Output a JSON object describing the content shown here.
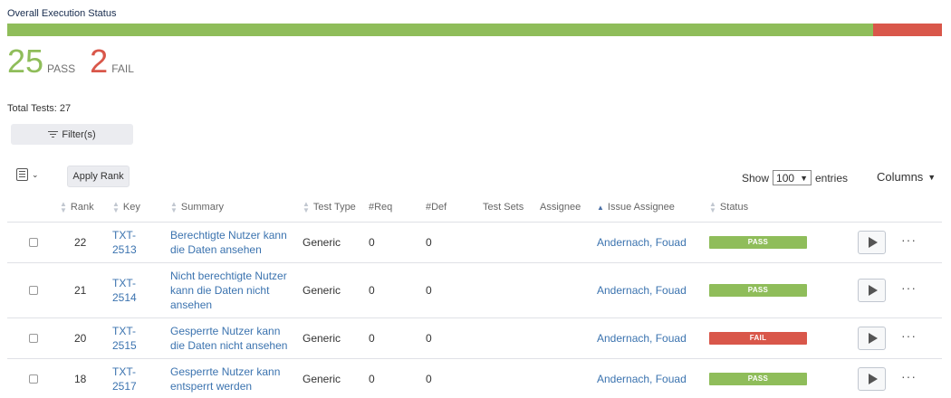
{
  "header": {
    "title": "Overall Execution Status"
  },
  "summary": {
    "pass_count": "25",
    "pass_label": "PASS",
    "fail_count": "2",
    "fail_label": "FAIL",
    "pass_fraction": 0.926,
    "total_tests": "Total Tests: 27"
  },
  "colors": {
    "pass": "#8fbd5a",
    "fail": "#d9574a",
    "link": "#3b73af"
  },
  "toolbar": {
    "filter_label": "Filter(s)",
    "apply_rank_label": "Apply Rank",
    "show_label": "Show",
    "entries_value": "100",
    "entries_label": "entries",
    "columns_label": "Columns"
  },
  "table": {
    "headers": {
      "rank": "Rank",
      "key": "Key",
      "summary": "Summary",
      "test_type": "Test Type",
      "req": "#Req",
      "def": "#Def",
      "test_sets": "Test Sets",
      "assignee": "Assignee",
      "issue_assignee": "Issue Assignee",
      "status": "Status"
    },
    "rows": [
      {
        "rank": "22",
        "key_line1": "TXT-",
        "key_line2": "2513",
        "summary_line1": "Berechtigte Nutzer kann",
        "summary_line2": "die Daten ansehen",
        "summary_line3": "",
        "test_type": "Generic",
        "req": "0",
        "def": "0",
        "issue_assignee": "Andernach, Fouad",
        "status": "PASS"
      },
      {
        "rank": "21",
        "key_line1": "TXT-",
        "key_line2": "2514",
        "summary_line1": "Nicht berechtigte Nutzer",
        "summary_line2": "kann die Daten nicht",
        "summary_line3": "ansehen",
        "test_type": "Generic",
        "req": "0",
        "def": "0",
        "issue_assignee": "Andernach, Fouad",
        "status": "PASS"
      },
      {
        "rank": "20",
        "key_line1": "TXT-",
        "key_line2": "2515",
        "summary_line1": "Gesperrte Nutzer kann",
        "summary_line2": "die Daten nicht ansehen",
        "summary_line3": "",
        "test_type": "Generic",
        "req": "0",
        "def": "0",
        "issue_assignee": "Andernach, Fouad",
        "status": "FAIL"
      },
      {
        "rank": "18",
        "key_line1": "TXT-",
        "key_line2": "2517",
        "summary_line1": "Gesperrte Nutzer kann",
        "summary_line2": "entsperrt werden",
        "summary_line3": "",
        "test_type": "Generic",
        "req": "0",
        "def": "0",
        "issue_assignee": "Andernach, Fouad",
        "status": "PASS"
      }
    ]
  }
}
